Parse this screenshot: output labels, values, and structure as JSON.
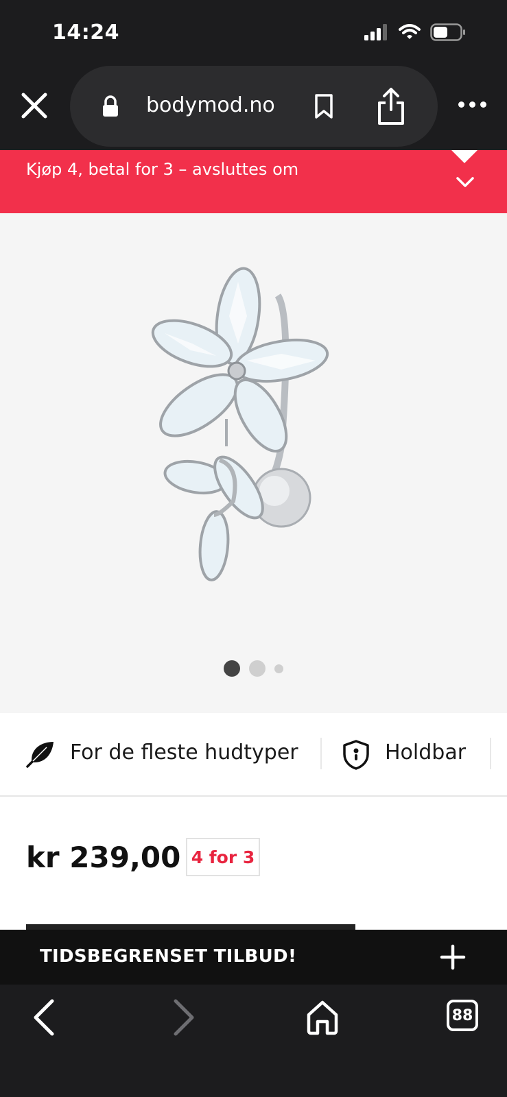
{
  "status_bar": {
    "time": "14:24"
  },
  "browser": {
    "domain": "bodymod.no",
    "tab_count": "88"
  },
  "banner": {
    "text": "Kjøp 4, betal for 3 – avsluttes om",
    "color": "#f2304b"
  },
  "gallery": {
    "image_count": 3,
    "active_index": 0
  },
  "features": [
    {
      "icon": "feather-icon",
      "label": "For de fleste hudtyper"
    },
    {
      "icon": "shield-icon",
      "label": "Holdbar"
    }
  ],
  "product": {
    "price": "kr 239,00",
    "badge": "4 for 3"
  },
  "promo": {
    "text": "TIDSBEGRENSET TILBUD!"
  },
  "colors": {
    "accent": "#f2304b",
    "badge_text": "#e8243f",
    "chrome": "#1c1c1e"
  }
}
